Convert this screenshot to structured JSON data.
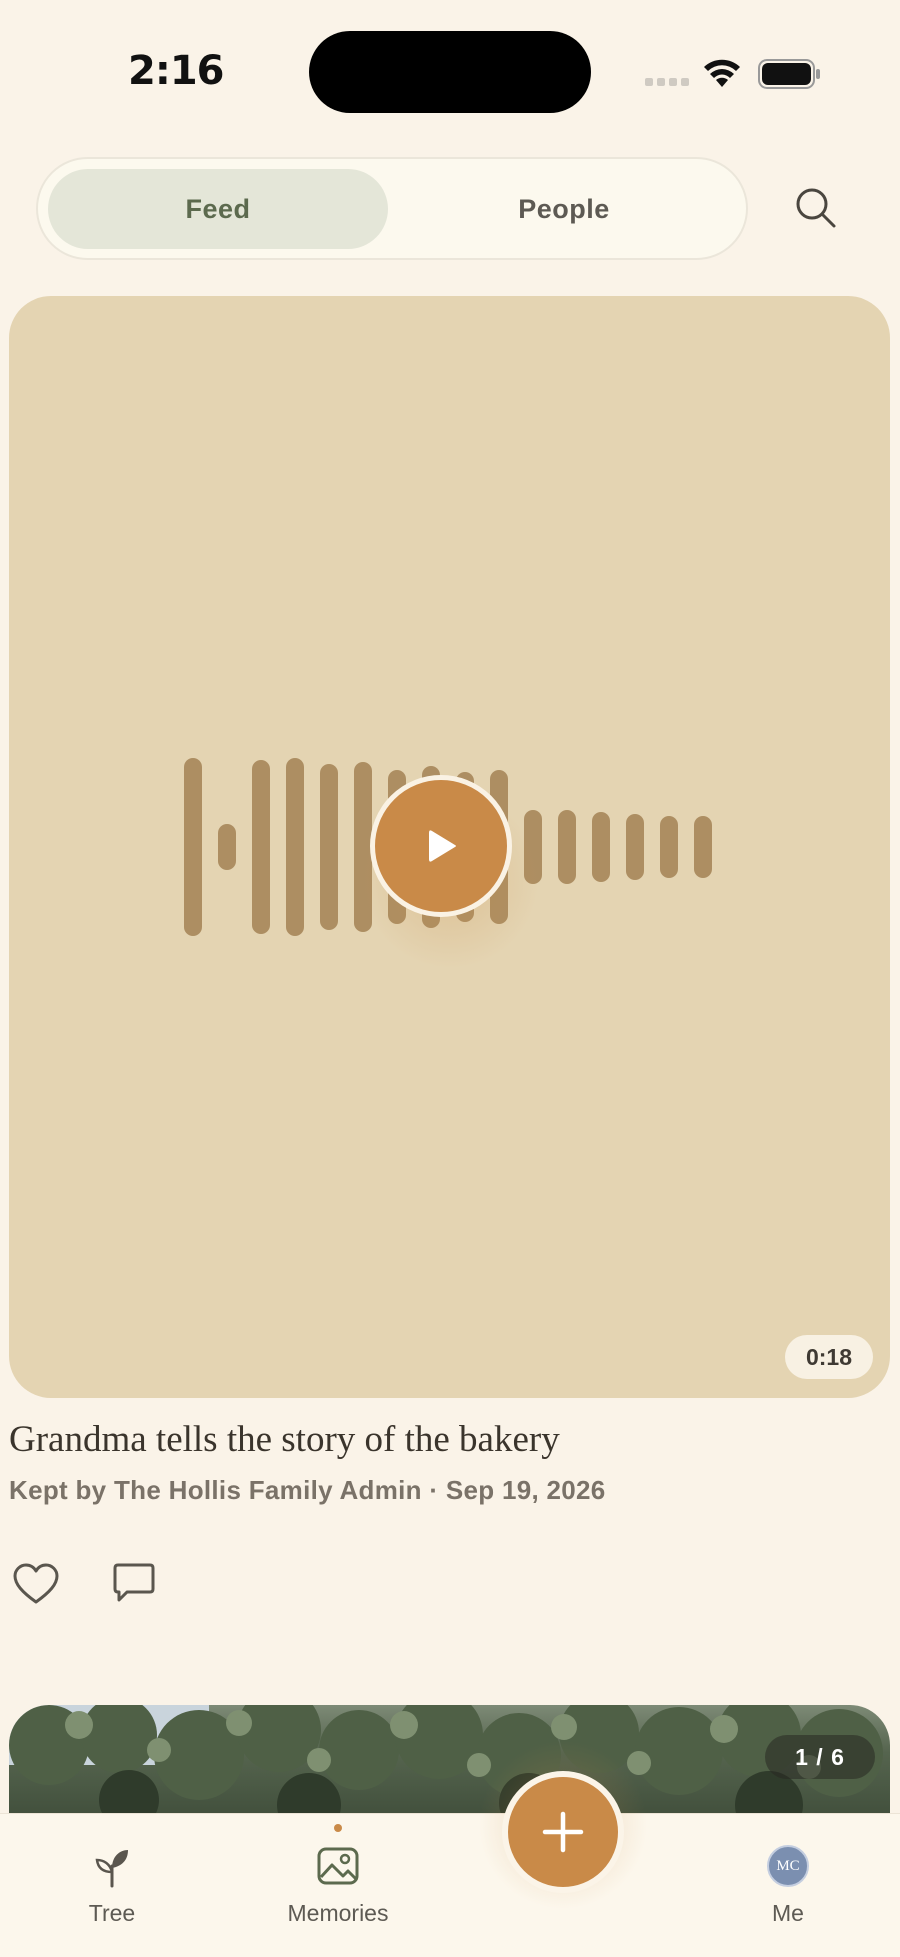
{
  "status_bar": {
    "time": "2:16"
  },
  "segment": {
    "feed_label": "Feed",
    "people_label": "People",
    "active": "Feed"
  },
  "post": {
    "duration": "0:18",
    "title": "Grandma tells the story of the bakery",
    "meta": "Kept by The Hollis Family Admin · Sep 19, 2026"
  },
  "next_post": {
    "page_indicator": "1 / 6"
  },
  "tab_bar": {
    "tree_label": "Tree",
    "memories_label": "Memories",
    "me_label": "Me",
    "avatar_initials": "MC",
    "active_tab": "Memories"
  },
  "colors": {
    "background": "#faf3e8",
    "accent": "#c98a48",
    "card": "#e4d4b2",
    "waveform": "#ad8e62",
    "feed_active": "#e4e6d8"
  },
  "icons": [
    "wifi-icon",
    "battery-icon",
    "search-icon",
    "play-icon",
    "heart-icon",
    "comment-icon",
    "sprout-icon",
    "image-icon",
    "plus-icon"
  ]
}
